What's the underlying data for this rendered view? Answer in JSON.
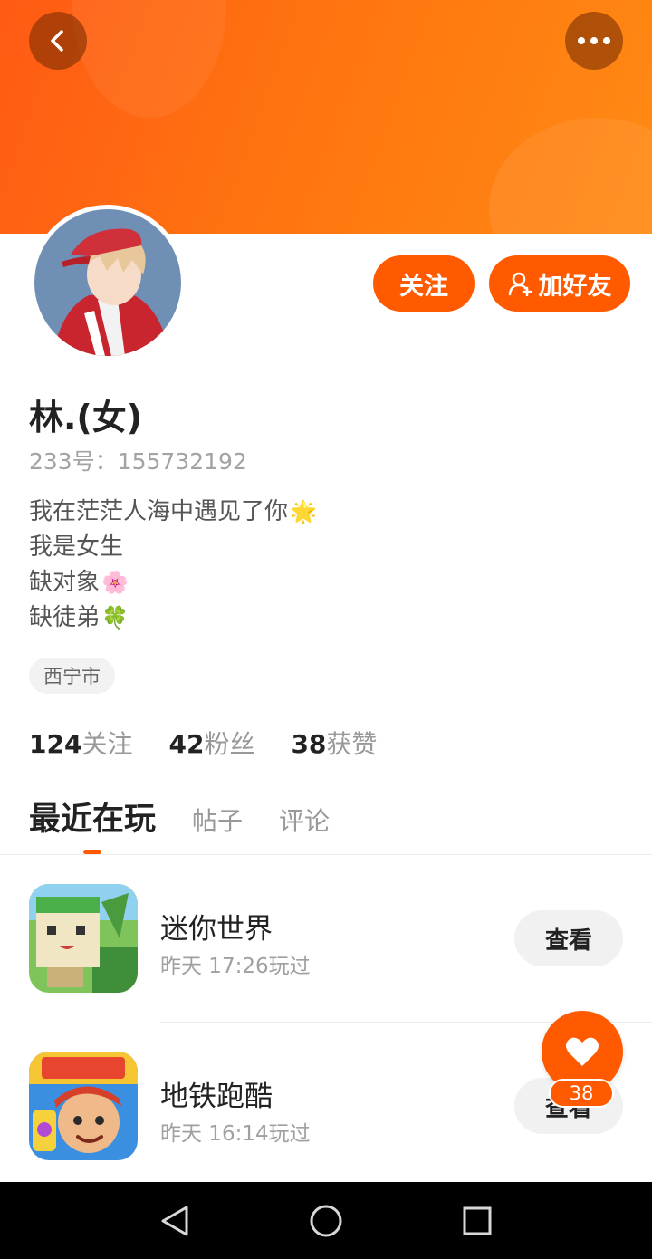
{
  "header": {
    "back_icon": "chevron-left-icon",
    "more_icon": "more-horizontal-icon"
  },
  "actions": {
    "follow_label": "关注",
    "add_friend_label": "加好友",
    "add_friend_icon": "user-plus-icon"
  },
  "profile": {
    "name": "林.(女)",
    "id_line": "233号：155732192",
    "bio": [
      {
        "text": "我在茫茫人海中遇见了你",
        "emoji": "🌟"
      },
      {
        "text": "我是女生",
        "emoji": ""
      },
      {
        "text": "缺对象",
        "emoji": "🌸"
      },
      {
        "text": "缺徒弟",
        "emoji": "🍀"
      }
    ],
    "location": "西宁市"
  },
  "stats": [
    {
      "num": "124",
      "label": "关注"
    },
    {
      "num": "42",
      "label": "粉丝"
    },
    {
      "num": "38",
      "label": "获赞"
    }
  ],
  "tabs": [
    {
      "label": "最近在玩",
      "active": true
    },
    {
      "label": "帖子",
      "active": false
    },
    {
      "label": "评论",
      "active": false
    }
  ],
  "games": [
    {
      "title": "迷你世界",
      "time": "昨天 17:26玩过",
      "button": "查看"
    },
    {
      "title": "地铁跑酷",
      "time": "昨天 16:14玩过",
      "button": "查看"
    }
  ],
  "like": {
    "icon": "heart-icon",
    "count": "38"
  },
  "colors": {
    "accent": "#ff5a00",
    "banner_start": "#ff5a14",
    "banner_end": "#ff8a14"
  },
  "navbar": {
    "back_icon": "triangle-back-icon",
    "home_icon": "circle-home-icon",
    "recents_icon": "square-recents-icon"
  }
}
